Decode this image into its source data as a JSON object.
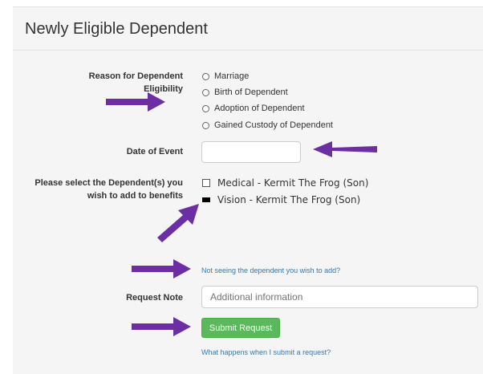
{
  "panel": {
    "title": "Newly Eligible Dependent"
  },
  "reason": {
    "label": "Reason for Dependent Eligibility",
    "options": [
      "Marriage",
      "Birth of Dependent",
      "Adoption of Dependent",
      "Gained Custody of Dependent"
    ]
  },
  "event_date": {
    "label": "Date of Event",
    "value": ""
  },
  "dependents": {
    "label_line1": "Please select the Dependent(s) you",
    "label_line2": "wish to add to benefits",
    "items": [
      {
        "label": "Medical - Kermit The Frog (Son)",
        "checked": false
      },
      {
        "label": "Vision - Kermit The Frog (Son)",
        "checked": true
      }
    ]
  },
  "missing_dependent_link": "Not seeing the dependent you wish to add?",
  "request_note": {
    "label": "Request Note",
    "placeholder": "Additional information"
  },
  "submit_label": "Submit Request",
  "help_link": "What happens when I submit a request?",
  "colors": {
    "arrow": "#6b2fa3",
    "submit": "#5cb85c",
    "link": "#337ab7",
    "panel": "#f5f5f5"
  },
  "annotations": {
    "arrow_icon": "purple-arrow-icon",
    "count": 5
  }
}
